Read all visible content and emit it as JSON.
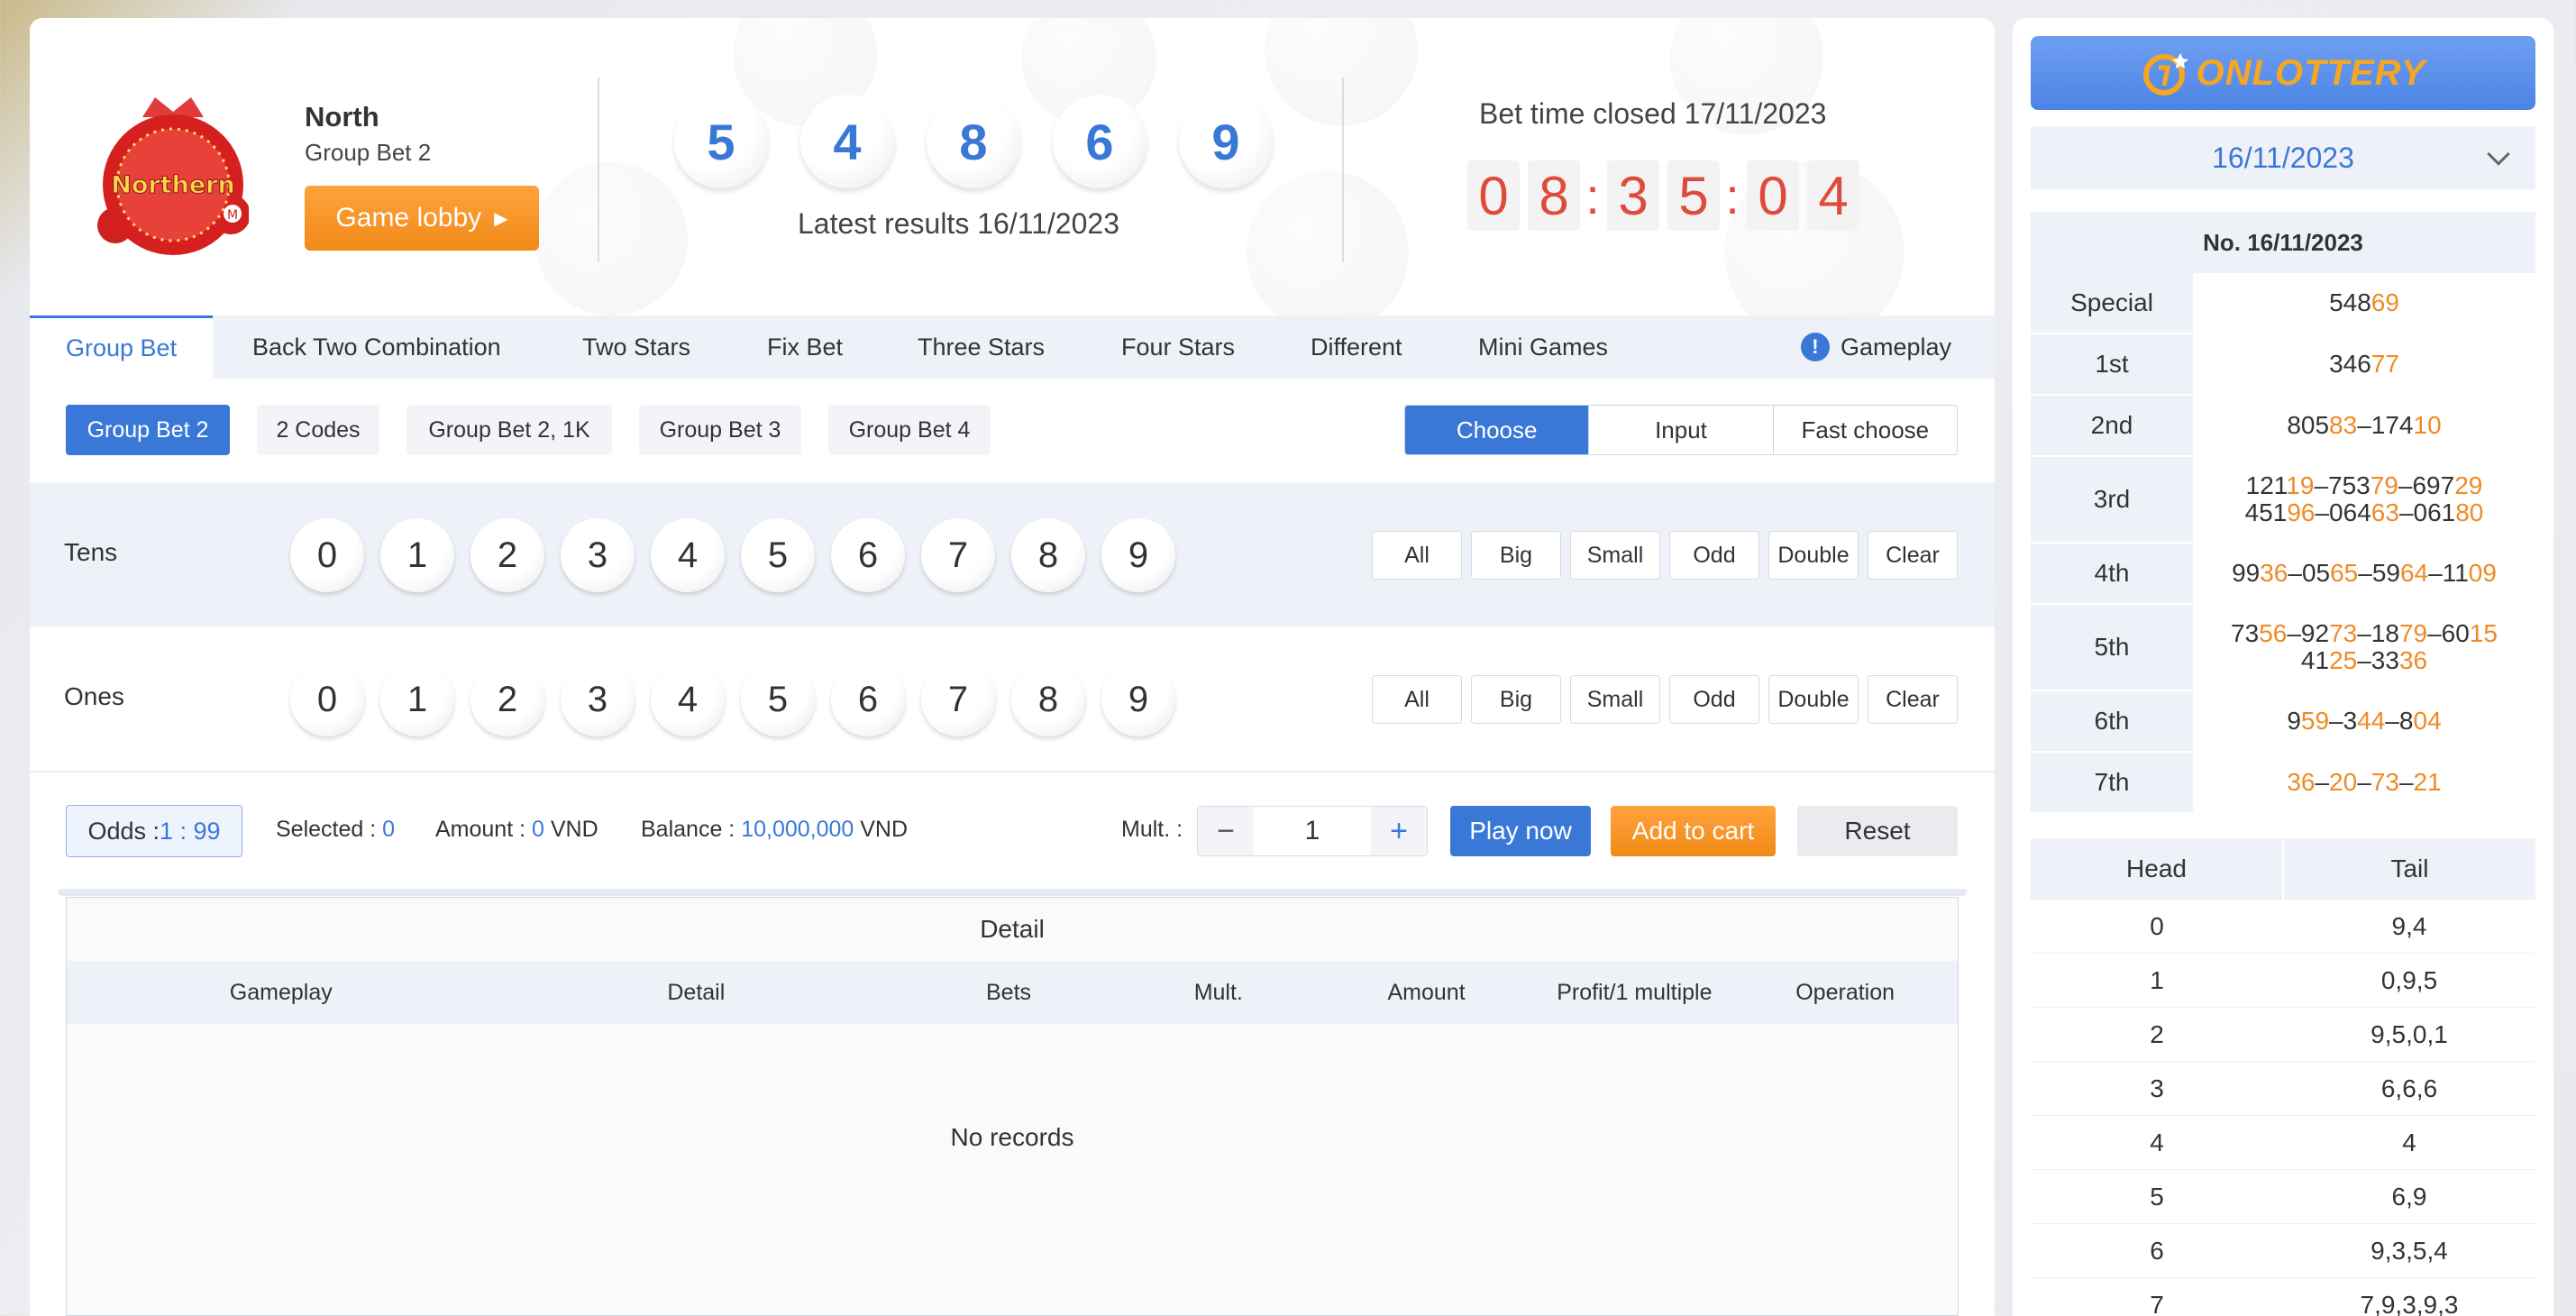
{
  "header": {
    "region": "North",
    "group": "Group Bet 2",
    "logo_text": "Northern",
    "lobby_label": "Game lobby",
    "results": [
      "5",
      "4",
      "8",
      "6",
      "9"
    ],
    "latest_label": "Latest results 16/11/2023",
    "closed_label": "Bet time closed 17/11/2023",
    "countdown": [
      "0",
      "8",
      ":",
      "3",
      "5",
      ":",
      "0",
      "4"
    ]
  },
  "tabs": [
    "Group Bet",
    "Back Two Combination",
    "Two Stars",
    "Fix Bet",
    "Three Stars",
    "Four Stars",
    "Different",
    "Mini Games"
  ],
  "gameplay_label": "Gameplay",
  "subtabs": [
    "Group Bet 2",
    "2 Codes",
    "Group Bet 2, 1K",
    "Group Bet 3",
    "Group Bet 4"
  ],
  "modes": [
    "Choose",
    "Input",
    "Fast choose"
  ],
  "rows": [
    {
      "label": "Tens",
      "numbers": [
        "0",
        "1",
        "2",
        "3",
        "4",
        "5",
        "6",
        "7",
        "8",
        "9"
      ]
    },
    {
      "label": "Ones",
      "numbers": [
        "0",
        "1",
        "2",
        "3",
        "4",
        "5",
        "6",
        "7",
        "8",
        "9"
      ]
    }
  ],
  "quick": [
    "All",
    "Big",
    "Small",
    "Odd",
    "Double",
    "Clear"
  ],
  "bet": {
    "odds_label": "Odds : ",
    "odds_value": "1 : 99",
    "selected_label": "Selected : ",
    "selected_value": "0",
    "amount_label": "Amount : ",
    "amount_value": "0",
    "currency": " VND",
    "balance_label": "Balance : ",
    "balance_value": "10,000,000",
    "mult_label": "Mult. :",
    "mult_value": "1",
    "minus": "−",
    "plus": "+",
    "play_label": "Play now",
    "cart_label": "Add to cart",
    "reset_label": "Reset"
  },
  "detail": {
    "title": "Detail",
    "columns": [
      "Gameplay",
      "Detail",
      "Bets",
      "Mult.",
      "Amount",
      "Profit/1 multiple",
      "Operation"
    ],
    "empty": "No records"
  },
  "side": {
    "brand": "ONLOTTERY",
    "date": "16/11/2023",
    "no_label": "No. 16/11/2023",
    "prizes": [
      {
        "label": "Special",
        "lines": [
          [
            [
              "548",
              ""
            ],
            [
              "69",
              "or"
            ]
          ]
        ]
      },
      {
        "label": "1st",
        "lines": [
          [
            [
              "346",
              ""
            ],
            [
              "77",
              "or"
            ]
          ]
        ]
      },
      {
        "label": "2nd",
        "lines": [
          [
            [
              "805",
              ""
            ],
            [
              "83",
              "or"
            ],
            [
              "–174",
              ""
            ],
            [
              "10",
              "or"
            ]
          ]
        ]
      },
      {
        "label": "3rd",
        "lines": [
          [
            [
              "121",
              ""
            ],
            [
              "19",
              "or"
            ],
            [
              "–753",
              ""
            ],
            [
              "79",
              "or"
            ],
            [
              "–697",
              ""
            ],
            [
              "29",
              "or"
            ]
          ],
          [
            [
              "451",
              ""
            ],
            [
              "96",
              "or"
            ],
            [
              "–064",
              ""
            ],
            [
              "63",
              "or"
            ],
            [
              "–061",
              ""
            ],
            [
              "80",
              "or"
            ]
          ]
        ]
      },
      {
        "label": "4th",
        "lines": [
          [
            [
              "99",
              ""
            ],
            [
              "36",
              "or"
            ],
            [
              "–05",
              ""
            ],
            [
              "65",
              "or"
            ],
            [
              "–59",
              ""
            ],
            [
              "64",
              "or"
            ],
            [
              "–11",
              ""
            ],
            [
              "09",
              "or"
            ]
          ]
        ]
      },
      {
        "label": "5th",
        "lines": [
          [
            [
              "73",
              ""
            ],
            [
              "56",
              "or"
            ],
            [
              "–92",
              ""
            ],
            [
              "73",
              "or"
            ],
            [
              "–18",
              ""
            ],
            [
              "79",
              "or"
            ],
            [
              "–60",
              ""
            ],
            [
              "15",
              "or"
            ]
          ],
          [
            [
              "41",
              ""
            ],
            [
              "25",
              "or"
            ],
            [
              "–33",
              ""
            ],
            [
              "36",
              "or"
            ]
          ]
        ]
      },
      {
        "label": "6th",
        "lines": [
          [
            [
              "9",
              ""
            ],
            [
              "59",
              "or"
            ],
            [
              "–3",
              ""
            ],
            [
              "44",
              "or"
            ],
            [
              "–8",
              ""
            ],
            [
              "04",
              "or"
            ]
          ]
        ]
      },
      {
        "label": "7th",
        "lines": [
          [
            [
              "36",
              "or"
            ],
            [
              "–",
              ""
            ],
            [
              "20",
              "or"
            ],
            [
              "–",
              ""
            ],
            [
              "73",
              "or"
            ],
            [
              "–",
              ""
            ],
            [
              "21",
              "or"
            ]
          ]
        ]
      }
    ],
    "ht_headers": [
      "Head",
      "Tail"
    ],
    "ht": [
      [
        "0",
        "9,4"
      ],
      [
        "1",
        "0,9,5"
      ],
      [
        "2",
        "9,5,0,1"
      ],
      [
        "3",
        "6,6,6"
      ],
      [
        "4",
        "4"
      ],
      [
        "5",
        "6,9"
      ],
      [
        "6",
        "9,3,5,4"
      ],
      [
        "7",
        "7,9,3,9,3"
      ]
    ]
  },
  "colors": {
    "accent": "#3a78d8",
    "orange": "#f08a24",
    "countdown": "#e04a3c"
  }
}
